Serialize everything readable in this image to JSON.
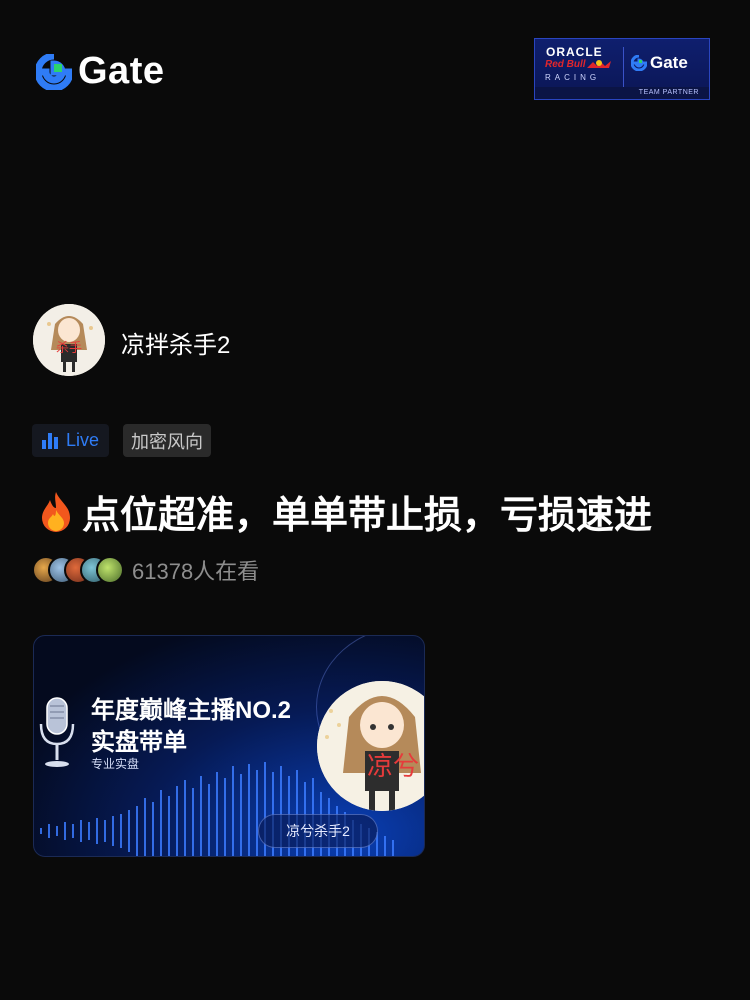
{
  "brand": {
    "name": "Gate"
  },
  "partner": {
    "oracle": "ORACLE",
    "redbull": "Red Bull",
    "racing": "RACING",
    "gate": "Gate",
    "team_partner": "TEAM PARTNER"
  },
  "host": {
    "name": "凉拌杀手2",
    "avatar_text": "杀手"
  },
  "tags": {
    "live": "Live",
    "category": "加密风向"
  },
  "headline": "点位超准，单单带止损，亏损速进",
  "viewers": {
    "count_text": "61378人在看"
  },
  "banner": {
    "title_line1": "年度巅峰主播NO.2",
    "title_line2": "实盘带单",
    "subtitle": "专业实盘",
    "host_pill": "凉兮杀手2",
    "photo_text": "凉兮"
  },
  "colors": {
    "accent_blue": "#2f7cf6",
    "brand_green": "#2cd46b",
    "background": "#0a0a0a"
  }
}
